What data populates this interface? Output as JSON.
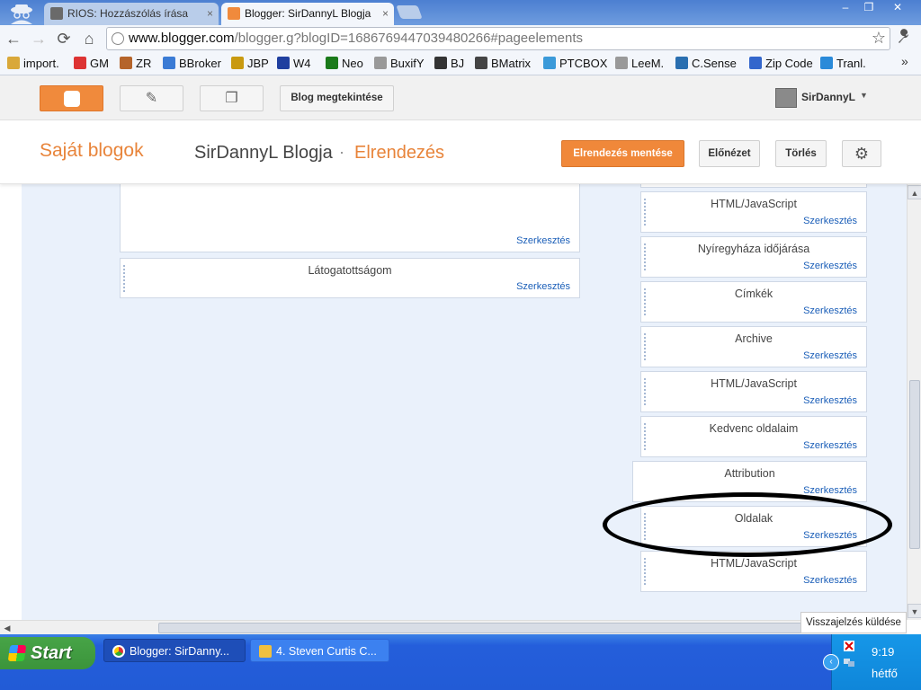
{
  "browser": {
    "tabs": [
      {
        "label": "RIOS: Hozzászólás írása",
        "state": "inactive",
        "close": "×"
      },
      {
        "label": "Blogger: SirDannyL Blogja",
        "state": "active",
        "close": "×"
      }
    ],
    "url_host": "www.blogger.com",
    "url_rest": "/blogger.g?blogID=1686769447039480266#pageelements",
    "window_controls": [
      "–",
      "❐",
      "✕"
    ],
    "nav_icons": {
      "back": "←",
      "forward": "→",
      "reload": "⟳",
      "home": "⌂",
      "star": "☆",
      "wrench": "🔧"
    },
    "bookmarks": [
      {
        "label": "import.",
        "icon": "folder-icon",
        "color": "#d9a83a"
      },
      {
        "label": "GM",
        "icon": "gmail-icon",
        "color": "#d33"
      },
      {
        "label": "ZR",
        "icon": "zr-icon",
        "color": "#b5642a"
      },
      {
        "label": "BBroker",
        "icon": "bbroker-icon",
        "color": "#3a7bd5"
      },
      {
        "label": "JBP",
        "icon": "dollar-icon",
        "color": "#c99a10"
      },
      {
        "label": "W4",
        "icon": "w4-icon",
        "color": "#1f3f9f"
      },
      {
        "label": "Neo",
        "icon": "neo-icon",
        "color": "#1a7a1a"
      },
      {
        "label": "BuxifY",
        "icon": "buxify-icon",
        "color": "#999"
      },
      {
        "label": "BJ",
        "icon": "bj-icon",
        "color": "#333"
      },
      {
        "label": "BMatrix",
        "icon": "bmatrix-icon",
        "color": "#444"
      },
      {
        "label": "PTCBOX",
        "icon": "ptcbox-icon",
        "color": "#3b9ad9"
      },
      {
        "label": "LeeM.",
        "icon": "leem-icon",
        "color": "#999"
      },
      {
        "label": "C.Sense",
        "icon": "csense-icon",
        "color": "#2a6fb0"
      },
      {
        "label": "Zip Code",
        "icon": "zipcode-icon",
        "color": "#3366cc"
      },
      {
        "label": "Tranl.",
        "icon": "translate-icon",
        "color": "#2a8ad9"
      }
    ],
    "bookmarks_more": "»"
  },
  "blogger": {
    "view_blog_label": "Blog megtekintése",
    "username": "SirDannyL",
    "user_dropdown": "▼",
    "icons": {
      "pen": "✎",
      "pages": "❐",
      "gear": "⚙"
    }
  },
  "header": {
    "my_blogs": "Saját blogok",
    "blog_name": "SirDannyL Blogja",
    "separator": "·",
    "section": "Elrendezés",
    "save_label": "Elrendezés mentése",
    "preview_label": "Előnézet",
    "delete_label": "Törlés",
    "accent_color": "#e8843a"
  },
  "main_column": {
    "widgets": [
      {
        "title": "",
        "edit": "Szerkesztés"
      },
      {
        "title": "Látogatottságom",
        "edit": "Szerkesztés"
      }
    ]
  },
  "sidebar": {
    "widgets": [
      {
        "title": "HTML/JavaScript",
        "edit": "Szerkesztés"
      },
      {
        "title": "Nyíregyháza időjárása",
        "edit": "Szerkesztés"
      },
      {
        "title": "Címkék",
        "edit": "Szerkesztés"
      },
      {
        "title": "Archive",
        "edit": "Szerkesztés"
      },
      {
        "title": "HTML/JavaScript",
        "edit": "Szerkesztés"
      },
      {
        "title": "Kedvenc oldalaim",
        "edit": "Szerkesztés"
      },
      {
        "title": "Attribution",
        "edit": "Szerkesztés"
      },
      {
        "title": "Oldalak",
        "edit": "Szerkesztés",
        "highlighted": true
      },
      {
        "title": "HTML/JavaScript",
        "edit": "Szerkesztés"
      }
    ]
  },
  "feedback_label": "Visszajelzés küldése",
  "taskbar": {
    "start_label": "Start",
    "tasks": [
      {
        "label": "Blogger: SirDanny...",
        "icon": "chrome-icon"
      },
      {
        "label": "4. Steven Curtis C...",
        "icon": "winamp-icon"
      }
    ],
    "time": "9:19",
    "day": "hétfő"
  }
}
